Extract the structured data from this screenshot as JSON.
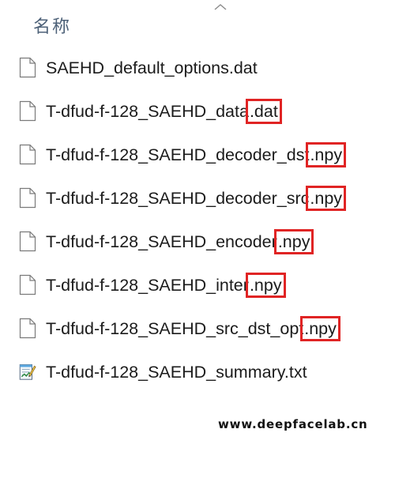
{
  "header": {
    "column_name": "名称"
  },
  "files": [
    {
      "base": "SAEHD_default_options.dat",
      "ext": "",
      "icon": "file-icon"
    },
    {
      "base": "T-dfud-f-128_SAEHD_data",
      "ext": ".dat",
      "icon": "file-icon"
    },
    {
      "base": "T-dfud-f-128_SAEHD_decoder_dst",
      "ext": ".npy",
      "icon": "file-icon"
    },
    {
      "base": "T-dfud-f-128_SAEHD_decoder_src",
      "ext": ".npy",
      "icon": "file-icon"
    },
    {
      "base": "T-dfud-f-128_SAEHD_encoder",
      "ext": ".npy",
      "icon": "file-icon"
    },
    {
      "base": "T-dfud-f-128_SAEHD_inter",
      "ext": ".npy",
      "icon": "file-icon"
    },
    {
      "base": "T-dfud-f-128_SAEHD_src_dst_opt",
      "ext": ".npy",
      "icon": "file-icon"
    },
    {
      "base": "T-dfud-f-128_SAEHD_summary.txt",
      "ext": "",
      "icon": "notepad-icon"
    }
  ],
  "highlight_color": "#e02424",
  "watermark": "www.deepfacelab.cn"
}
